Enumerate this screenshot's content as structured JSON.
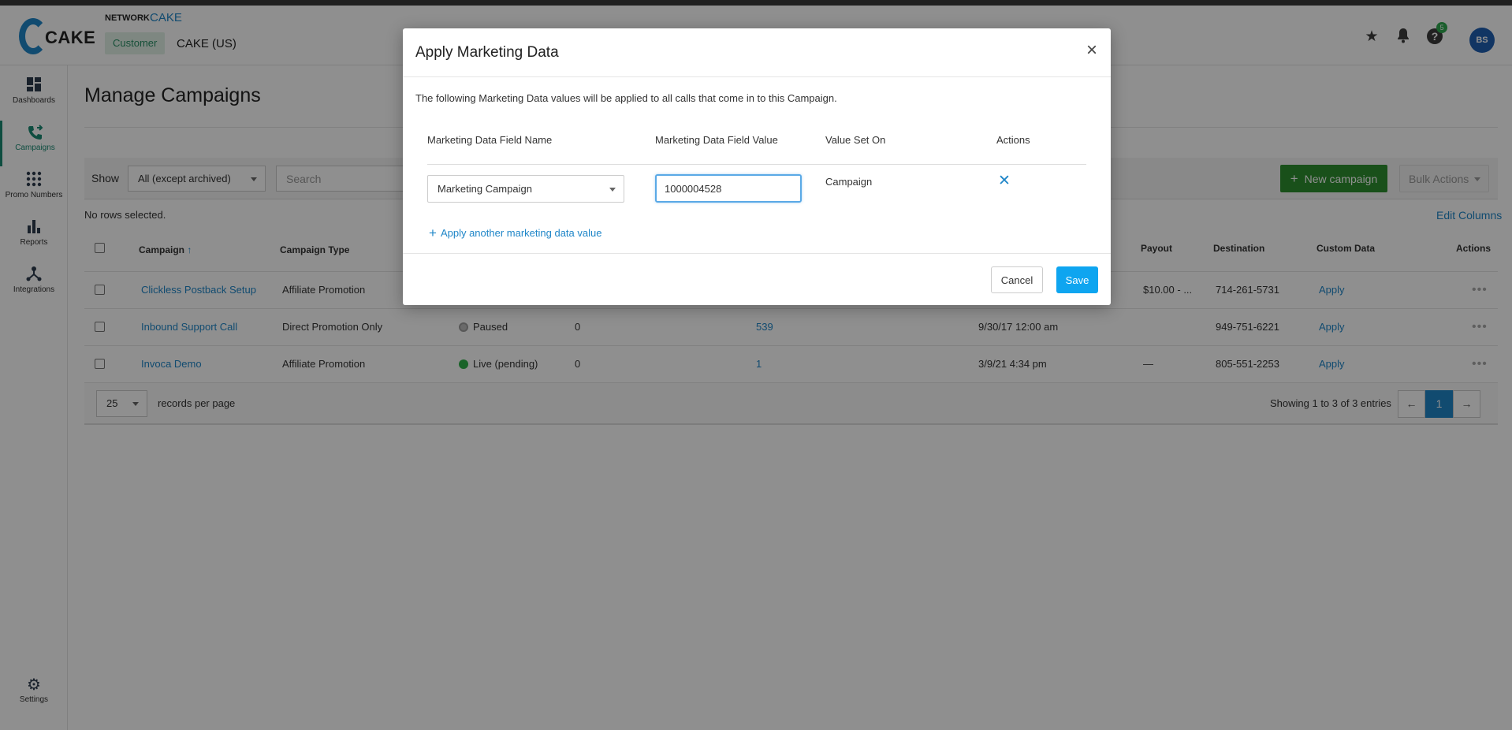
{
  "app": {
    "logo_text": "CAKE",
    "network_label": "NETWORK",
    "network_name": "CAKE",
    "customer_label": "Customer",
    "customer_name": "CAKE (US)"
  },
  "header": {
    "icons": [
      "star-icon",
      "bell-icon",
      "help-icon"
    ],
    "help_badge": "5",
    "avatar_initials": "BS"
  },
  "sidebar": {
    "items": [
      {
        "label": "Dashboards",
        "icon": "dashboard-icon"
      },
      {
        "label": "Campaigns",
        "icon": "phone-forward-icon",
        "active": true
      },
      {
        "label": "Promo Numbers",
        "icon": "keypad-icon"
      },
      {
        "label": "Reports",
        "icon": "bar-chart-icon"
      },
      {
        "label": "Integrations",
        "icon": "network-icon"
      },
      {
        "label": "Settings",
        "icon": "gear-icon"
      }
    ]
  },
  "page": {
    "title": "Manage Campaigns"
  },
  "filters": {
    "show_label": "Show",
    "show_value": "All (except archived)",
    "search_placeholder": "Search",
    "new_campaign": "New campaign",
    "bulk_actions": "Bulk Actions"
  },
  "selection": {
    "no_rows": "No rows selected.",
    "edit_columns": "Edit Columns"
  },
  "table": {
    "columns": {
      "campaign": "Campaign",
      "campaign_type": "Campaign Type",
      "payout": "Payout",
      "destination": "Destination",
      "custom_data": "Custom Data",
      "actions": "Actions"
    },
    "rows": [
      {
        "campaign": "Clickless Postback Setup",
        "type": "Affiliate Promotion",
        "status": "",
        "count": "",
        "numbers": "",
        "date": "",
        "payout": "$10.00 - ...",
        "destination": "714-261-5731",
        "custom_data": "Apply"
      },
      {
        "campaign": "Inbound Support Call",
        "type": "Direct Promotion Only",
        "status": "Paused",
        "count": "0",
        "numbers": "539",
        "date": "9/30/17 12:00 am",
        "payout": "",
        "destination": "949-751-6221",
        "custom_data": "Apply"
      },
      {
        "campaign": "Invoca Demo",
        "type": "Affiliate Promotion",
        "status": "Live (pending)",
        "count": "0",
        "numbers": "1",
        "date": "3/9/21 4:34 pm",
        "payout": "—",
        "destination": "805-551-2253",
        "custom_data": "Apply"
      }
    ]
  },
  "pager": {
    "per_page": "25",
    "per_page_label": "records per page",
    "showing": "Showing 1 to 3 of 3 entries",
    "prev": "←",
    "current": "1",
    "next": "→"
  },
  "modal": {
    "title": "Apply Marketing Data",
    "close": "×",
    "description": "The following Marketing Data values will be applied to all calls that come in to this Campaign.",
    "headers": {
      "field_name": "Marketing Data Field Name",
      "field_value": "Marketing Data Field Value",
      "value_set_on": "Value Set On",
      "actions": "Actions"
    },
    "row": {
      "field_name": "Marketing Campaign",
      "field_value": "1000004528",
      "value_set_on": "Campaign",
      "remove": "✕"
    },
    "apply_another": "Apply another marketing data value",
    "cancel": "Cancel",
    "save": "Save"
  },
  "colors": {
    "brand_blue": "#1f86c8",
    "active_green": "#1a8a73",
    "new_campaign_green": "#2d8f2f",
    "save_blue": "#0ea5f0",
    "paused": "#9e9e9e",
    "live": "#2fb14a"
  }
}
